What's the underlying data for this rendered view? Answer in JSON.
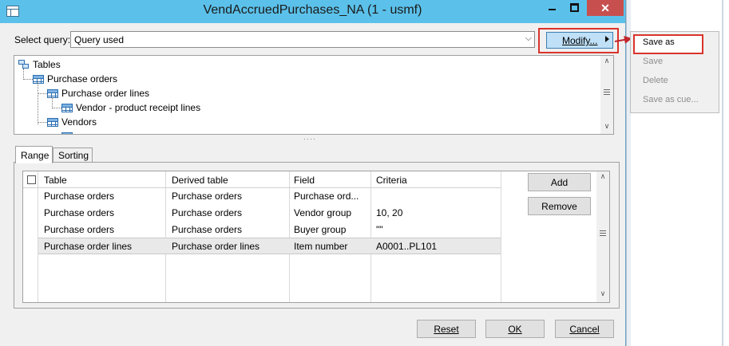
{
  "window": {
    "title": "VendAccruedPurchases_NA (1 - usmf)",
    "min_glyph": "–",
    "max_glyph": "□",
    "close_glyph": "✕"
  },
  "query": {
    "label": "Select query:",
    "value": "Query used",
    "dropdown_glyph": "⌵",
    "modify_label": "Modify..."
  },
  "menu": {
    "items": [
      {
        "label": "Save as",
        "enabled": true
      },
      {
        "label": "Save",
        "enabled": false
      },
      {
        "label": "Delete",
        "enabled": false
      },
      {
        "label": "Save as cue...",
        "enabled": false
      }
    ]
  },
  "tree": {
    "root": "Tables",
    "nodes": [
      {
        "label": "Purchase orders"
      },
      {
        "label": "Purchase order lines"
      },
      {
        "label": "Vendor - product receipt lines"
      },
      {
        "label": "Vendors"
      }
    ],
    "scroll_up": "∧",
    "scroll_down": "∨"
  },
  "tabs": {
    "range": "Range",
    "sorting": "Sorting"
  },
  "grid": {
    "columns": [
      "Table",
      "Derived table",
      "Field",
      "Criteria"
    ],
    "rows": [
      {
        "table": "Purchase orders",
        "derived": "Purchase orders",
        "field": "Purchase ord...",
        "criteria": ""
      },
      {
        "table": "Purchase orders",
        "derived": "Purchase orders",
        "field": "Vendor group",
        "criteria": "10, 20"
      },
      {
        "table": "Purchase orders",
        "derived": "Purchase orders",
        "field": "Buyer group",
        "criteria": "\"\""
      },
      {
        "table": "Purchase order lines",
        "derived": "Purchase order lines",
        "field": "Item number",
        "criteria": "A0001..PL101"
      }
    ],
    "selected_row": 4
  },
  "buttons": {
    "add": "Add",
    "remove": "Remove",
    "reset": "Reset",
    "ok": "OK",
    "cancel": "Cancel"
  },
  "colors": {
    "titlebar": "#5bc1ea",
    "close": "#c7504f",
    "highlight": "#d9342b",
    "modify_bg": "#bfe0f7"
  }
}
